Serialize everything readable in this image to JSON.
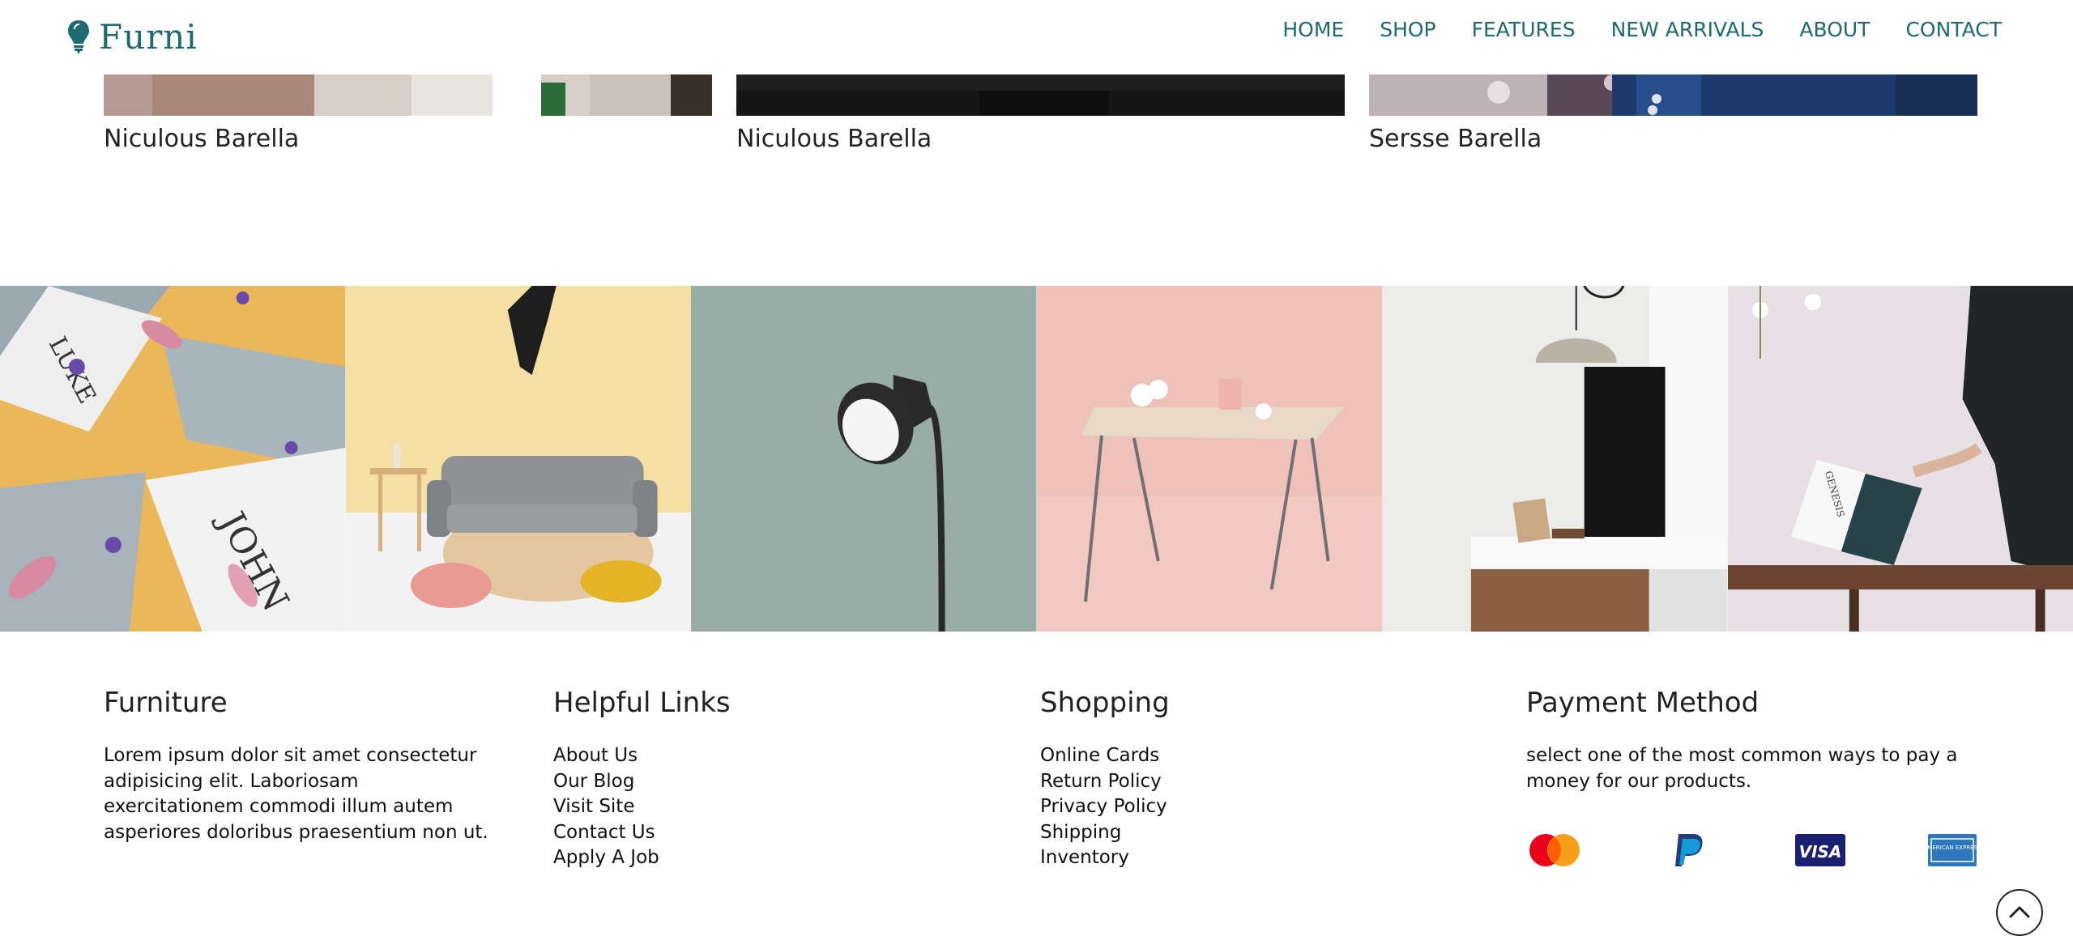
{
  "brand": {
    "name": "Furni",
    "accent_color": "#1e6a70"
  },
  "nav": {
    "items": [
      {
        "label": "HOME"
      },
      {
        "label": "SHOP"
      },
      {
        "label": "FEATURES"
      },
      {
        "label": "NEW ARRIVALS"
      },
      {
        "label": "ABOUT"
      },
      {
        "label": "CONTACT"
      }
    ]
  },
  "team": {
    "members": [
      {
        "name": "Niculous Barella"
      },
      {
        "name": "Niculous Barella"
      },
      {
        "name": "Sersse Barella"
      }
    ]
  },
  "gallery": {
    "tiles": [
      {
        "icon": "magazine-books-photo",
        "book1": "LUKE",
        "book2": "JOHN"
      },
      {
        "icon": "sofa-jump-photo"
      },
      {
        "icon": "floor-lamp-photo"
      },
      {
        "icon": "pink-table-photo"
      },
      {
        "icon": "pendant-lamp-photo"
      },
      {
        "icon": "book-reading-photo",
        "book": "GENESIS"
      }
    ]
  },
  "footer": {
    "furniture": {
      "heading": "Furniture",
      "text": "Lorem ipsum dolor sit amet consectetur adipisicing elit. Laboriosam exercitationem commodi illum autem asperiores doloribus praesentium non ut."
    },
    "helpful_links": {
      "heading": "Helpful Links",
      "items": [
        "About Us",
        "Our Blog",
        "Visit Site",
        "Contact Us",
        "Apply A Job"
      ]
    },
    "shopping": {
      "heading": "Shopping",
      "items": [
        "Online Cards",
        "Return Policy",
        "Privacy Policy",
        "Shipping",
        "Inventory"
      ]
    },
    "payment": {
      "heading": "Payment Method",
      "text": "select one of the most common ways to pay a money for our products.",
      "methods": [
        {
          "icon": "mastercard-icon"
        },
        {
          "icon": "paypal-icon"
        },
        {
          "icon": "visa-icon",
          "label": "VISA"
        },
        {
          "icon": "amex-icon",
          "label": "AMERICAN EXPRESS"
        }
      ]
    }
  },
  "scroll_top": {
    "icon": "chevron-up-icon"
  }
}
